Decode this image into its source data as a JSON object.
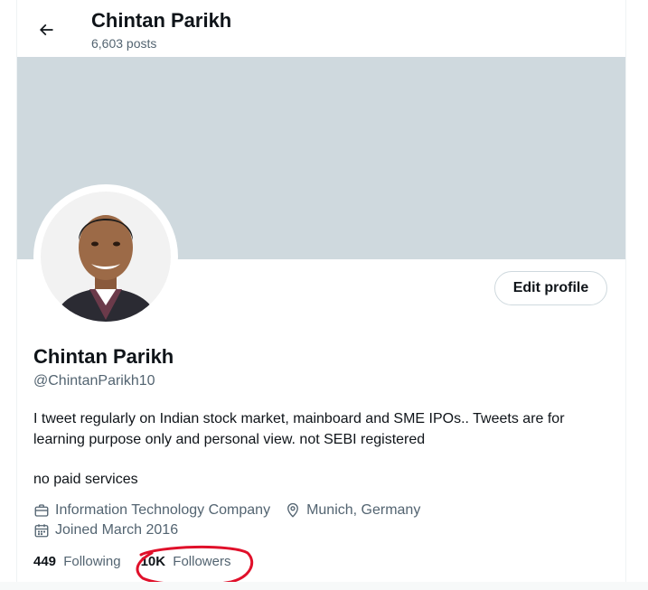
{
  "header": {
    "title": "Chintan Parikh",
    "subtitle": "6,603 posts"
  },
  "profile": {
    "name": "Chintan Parikh",
    "handle": "@ChintanParikh10",
    "edit_label": "Edit profile",
    "bio_line1": "I tweet regularly on Indian stock market, mainboard and SME IPOs.. Tweets are for learning purpose only and personal view. not SEBI registered",
    "bio_line2": "no paid services",
    "category": "Information Technology Company",
    "location": "Munich, Germany",
    "joined": "Joined March 2016"
  },
  "stats": {
    "following_count": "449",
    "following_label": "Following",
    "followers_count": "10K",
    "followers_label": "Followers"
  },
  "colors": {
    "banner": "#cfd9de",
    "muted": "#536471",
    "annotation": "#e0102a"
  },
  "icons": [
    "back-arrow-icon",
    "briefcase-icon",
    "location-pin-icon",
    "calendar-icon"
  ]
}
